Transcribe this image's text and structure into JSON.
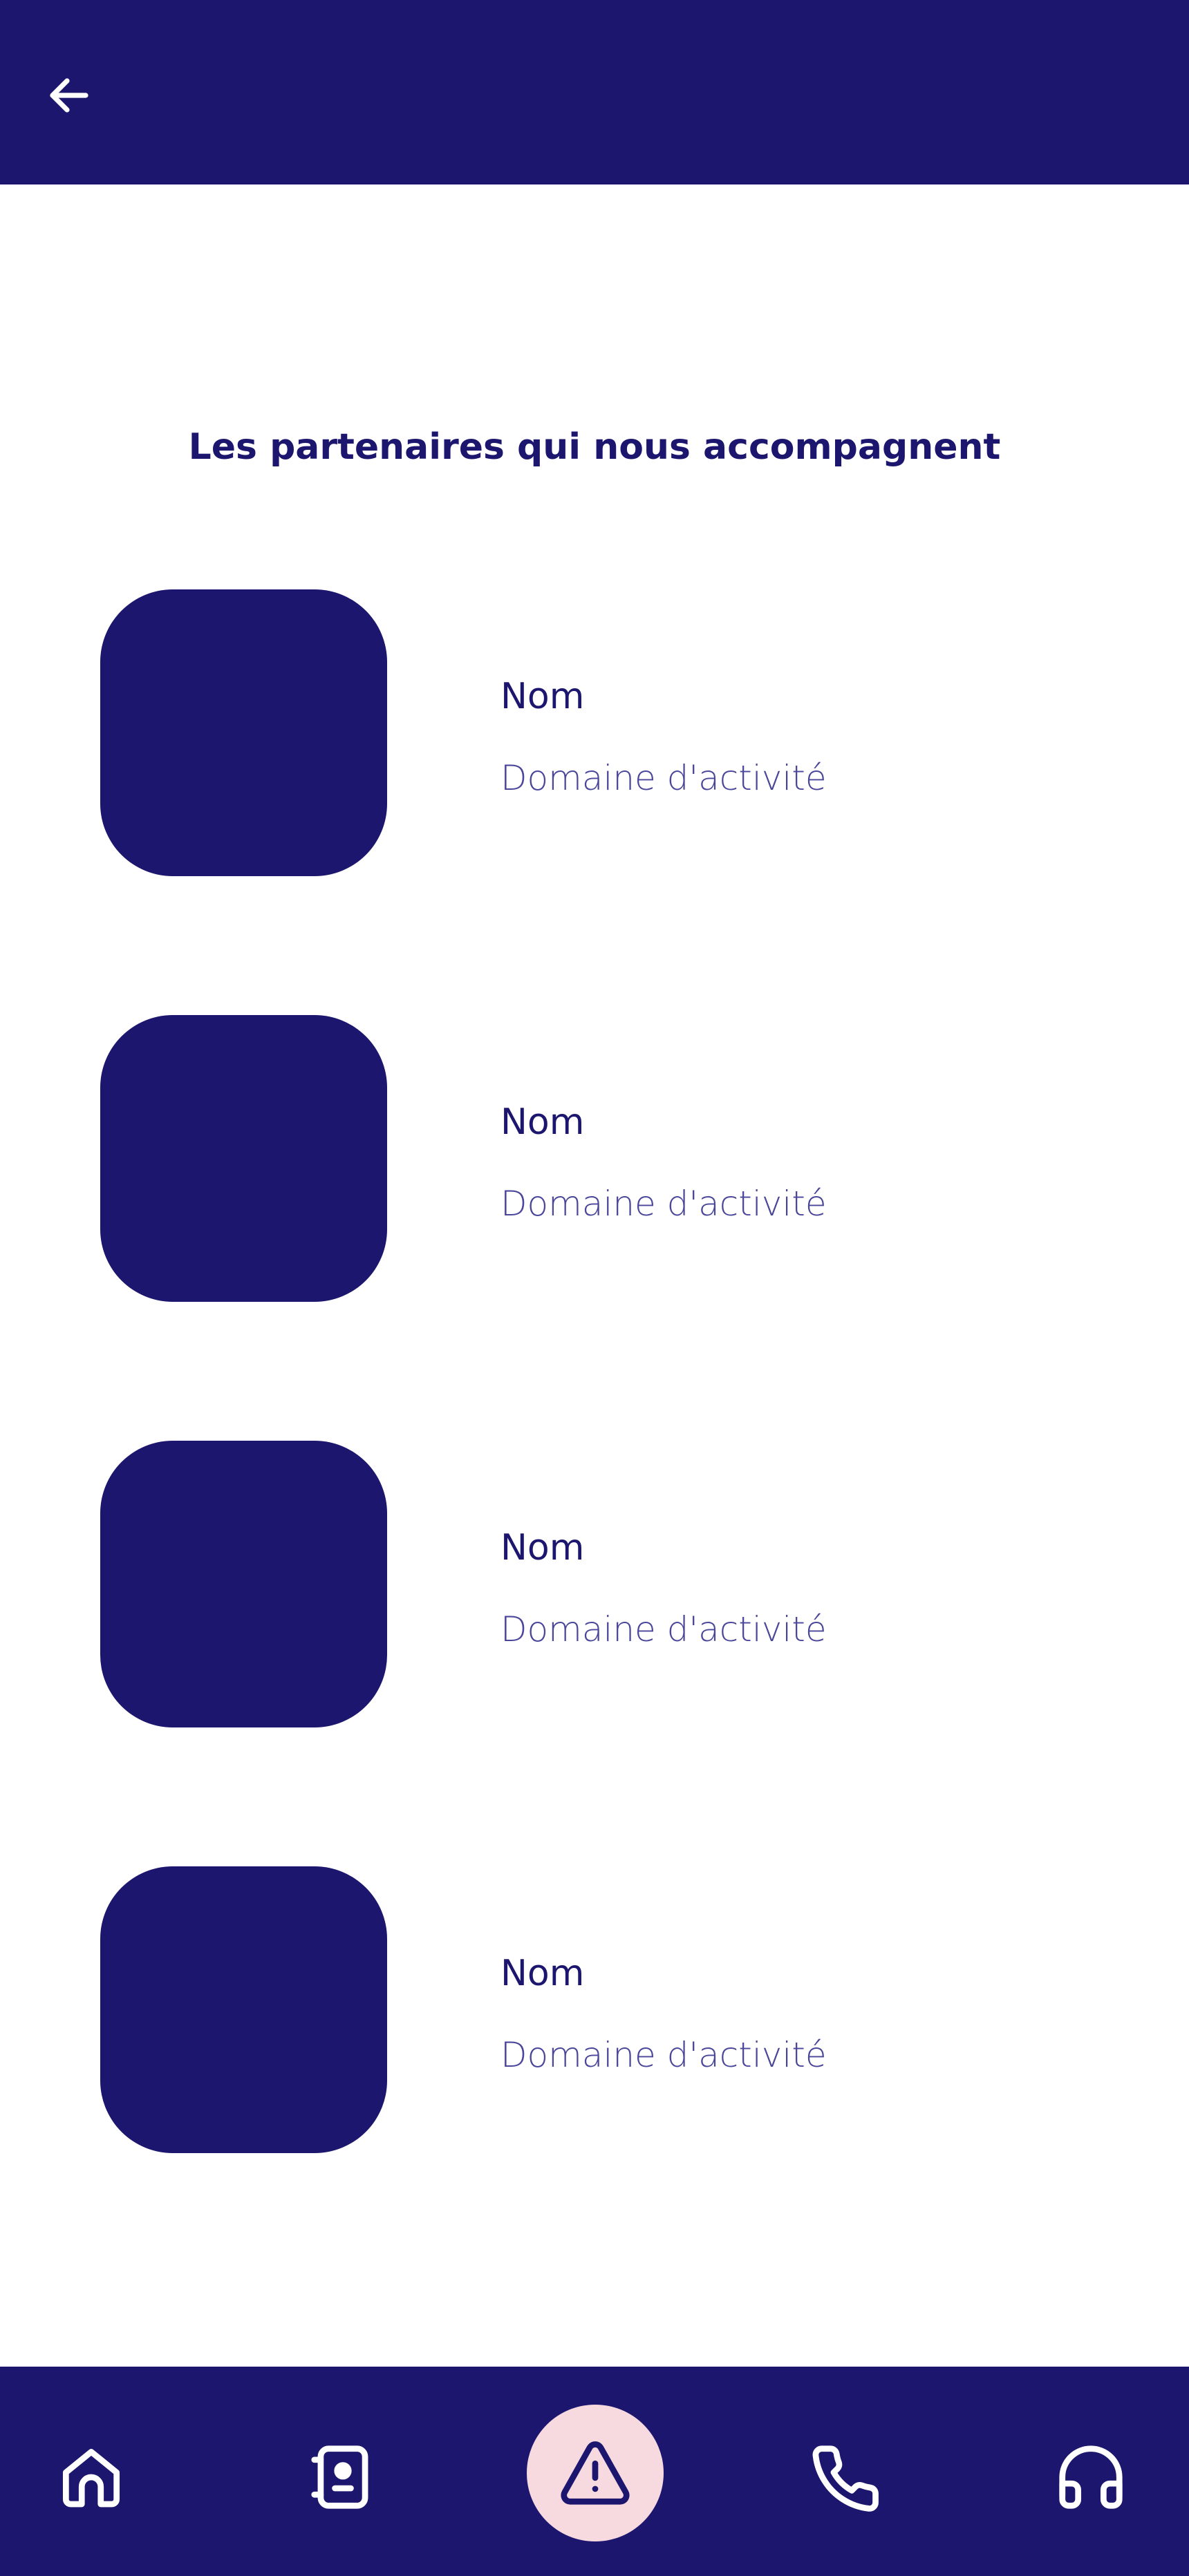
{
  "header": {
    "back_icon": "arrow-left-icon"
  },
  "section": {
    "title": "Les partenaires qui nous accompagnent"
  },
  "partners": [
    {
      "name": "Nom",
      "domain": "Domaine d'activité"
    },
    {
      "name": "Nom",
      "domain": "Domaine d'activité"
    },
    {
      "name": "Nom",
      "domain": "Domaine d'activité"
    },
    {
      "name": "Nom",
      "domain": "Domaine d'activité"
    }
  ],
  "bottom_nav": {
    "items": [
      {
        "icon": "home-icon"
      },
      {
        "icon": "id-card-icon"
      },
      {
        "icon": "warning-icon",
        "active": true
      },
      {
        "icon": "phone-icon"
      },
      {
        "icon": "headphones-icon"
      }
    ]
  },
  "colors": {
    "primary": "#1c166e",
    "accent_bg": "#f7d9e0",
    "secondary_text": "#4a4699",
    "background": "#ffffff"
  }
}
